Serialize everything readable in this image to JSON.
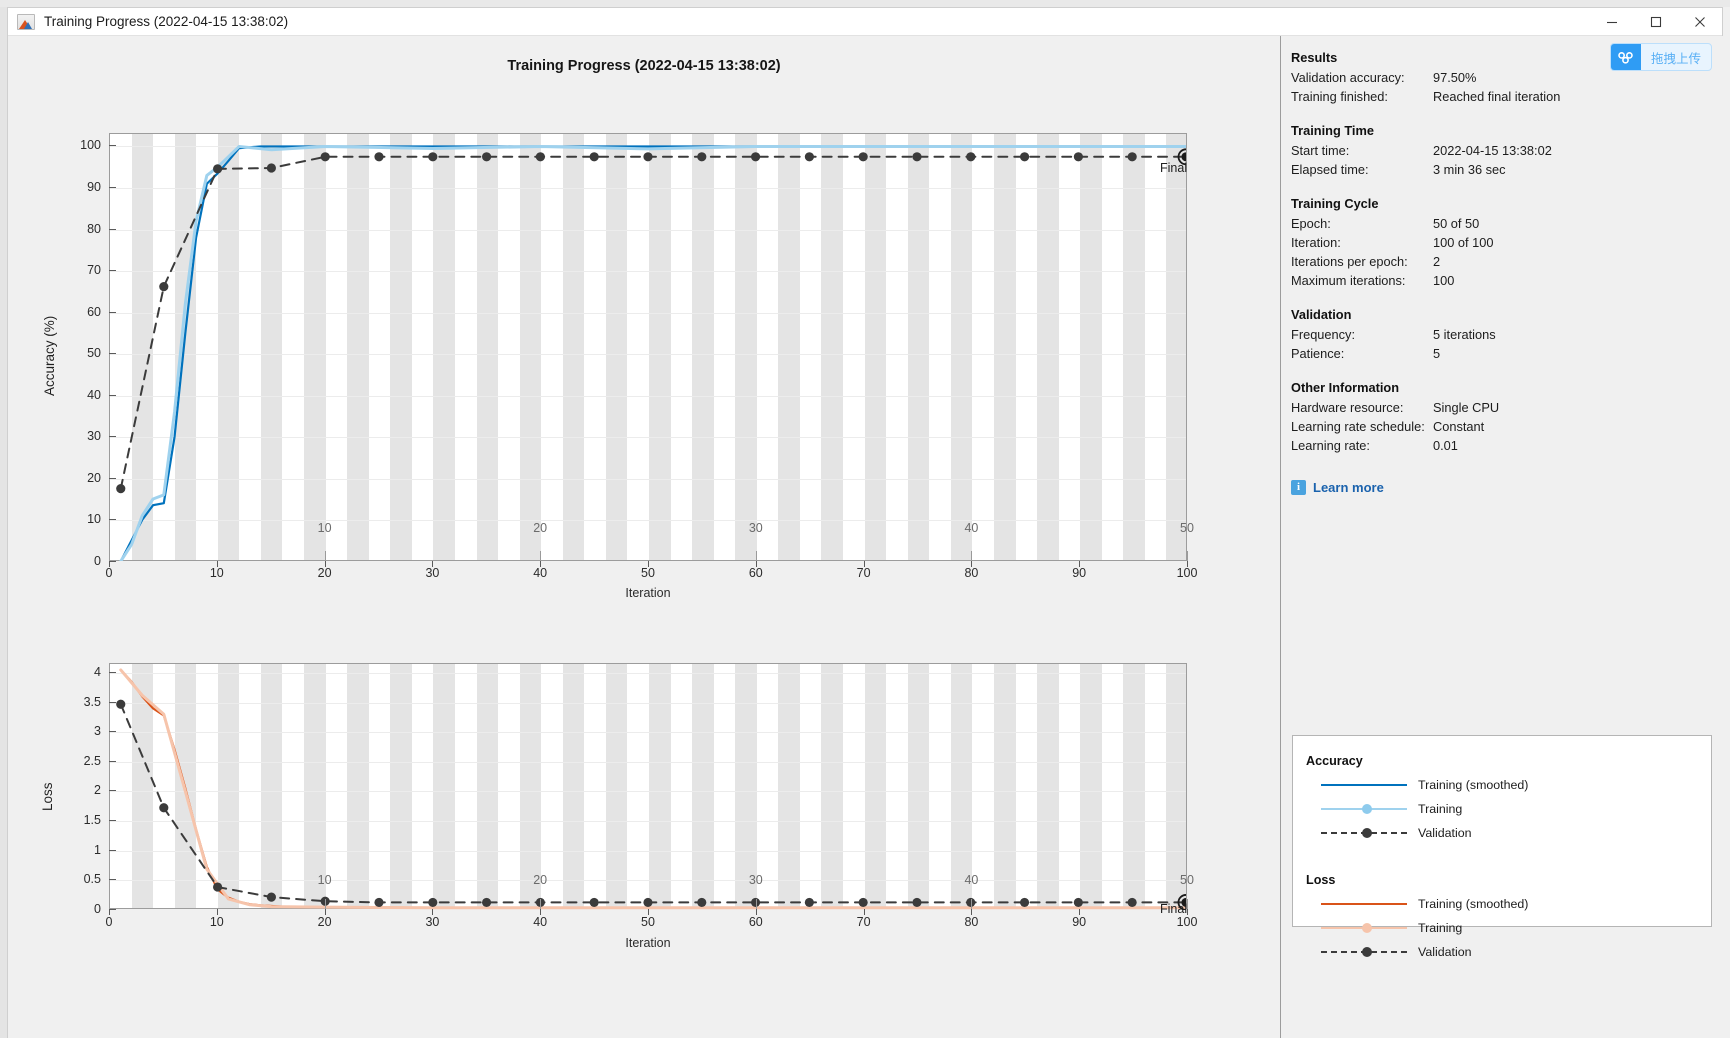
{
  "window": {
    "title": "Training Progress (2022-04-15 13:38:02)",
    "icon": "matlab-icon",
    "minimize_label": "—",
    "maximize_label": "□",
    "close_label": "×"
  },
  "overlay": {
    "upload_icon": "baidu-netdisk-icon",
    "upload_label": "拖拽上传"
  },
  "plot": {
    "title": "Training Progress (2022-04-15 13:38:02)",
    "final_label_top": "Final",
    "final_label_bottom": "Final"
  },
  "info": {
    "sections": [
      {
        "heading": "Results",
        "rows": [
          {
            "key": "Validation accuracy:",
            "value": "97.50%"
          },
          {
            "key": "Training finished:",
            "value": "Reached final iteration"
          }
        ]
      },
      {
        "heading": "Training Time",
        "rows": [
          {
            "key": "Start time:",
            "value": "2022-04-15 13:38:02"
          },
          {
            "key": "Elapsed time:",
            "value": "3 min 36 sec"
          }
        ]
      },
      {
        "heading": "Training Cycle",
        "rows": [
          {
            "key": "Epoch:",
            "value": "50 of 50"
          },
          {
            "key": "Iteration:",
            "value": "100 of 100"
          },
          {
            "key": "Iterations per epoch:",
            "value": "2"
          },
          {
            "key": "Maximum iterations:",
            "value": "100"
          }
        ]
      },
      {
        "heading": "Validation",
        "rows": [
          {
            "key": "Frequency:",
            "value": "5 iterations"
          },
          {
            "key": "Patience:",
            "value": "5"
          }
        ]
      },
      {
        "heading": "Other Information",
        "rows": [
          {
            "key": "Hardware resource:",
            "value": "Single CPU"
          },
          {
            "key": "Learning rate schedule:",
            "value": "Constant"
          },
          {
            "key": "Learning rate:",
            "value": "0.01"
          }
        ]
      }
    ],
    "learn_more": {
      "icon": "info-icon",
      "label": "Learn more"
    }
  },
  "legend": {
    "groups": [
      {
        "title": "Accuracy",
        "items": [
          {
            "label": "Training (smoothed)",
            "style": "solid",
            "color": "#0072bd",
            "marker": false
          },
          {
            "label": "Training",
            "style": "solid",
            "color": "#9fd2ee",
            "marker": true,
            "marker_color": "#8ecbed"
          },
          {
            "label": "Validation",
            "style": "dashed",
            "color": "#3b3b3b",
            "marker": true,
            "marker_color": "#3b3b3b"
          }
        ]
      },
      {
        "title": "Loss",
        "items": [
          {
            "label": "Training (smoothed)",
            "style": "solid",
            "color": "#d95319",
            "marker": false
          },
          {
            "label": "Training",
            "style": "solid",
            "color": "#f6c4ab",
            "marker": true,
            "marker_color": "#f6c4ab"
          },
          {
            "label": "Validation",
            "style": "dashed",
            "color": "#3b3b3b",
            "marker": true,
            "marker_color": "#3b3b3b"
          }
        ]
      }
    ]
  },
  "chart_data": [
    {
      "id": "accuracy-chart",
      "type": "line",
      "title": "Accuracy",
      "xlabel": "Iteration",
      "ylabel": "Accuracy (%)",
      "xlim": [
        0,
        100
      ],
      "ylim": [
        0,
        103
      ],
      "xticks": [
        0,
        10,
        20,
        30,
        40,
        50,
        60,
        70,
        80,
        90,
        100
      ],
      "yticks": [
        0,
        10,
        20,
        30,
        40,
        50,
        60,
        70,
        80,
        90,
        100
      ],
      "epoch_ticks": [
        10,
        20,
        30,
        40,
        50
      ],
      "epoch_tick_iterations": [
        20,
        40,
        60,
        80,
        100
      ],
      "grid": true,
      "epoch_bands": true,
      "iterations_per_epoch": 2,
      "series": [
        {
          "name": "Training (smoothed)",
          "color": "#0072bd",
          "style": "solid",
          "x": [
            1,
            2,
            3,
            4,
            5,
            6,
            7,
            8,
            9,
            10,
            11,
            12,
            14,
            16,
            18,
            20,
            30,
            40,
            50,
            60,
            70,
            80,
            90,
            100
          ],
          "y": [
            0,
            5,
            10,
            13.5,
            14,
            30,
            55,
            78,
            91,
            93.5,
            96.5,
            99.6,
            100,
            100,
            100,
            100,
            100,
            100,
            100,
            100,
            100,
            100,
            100,
            100
          ]
        },
        {
          "name": "Training",
          "color": "#9fd2ee",
          "style": "solid",
          "x": [
            1,
            2,
            3,
            4,
            5,
            6,
            7,
            8,
            9,
            10,
            11,
            12,
            15,
            20,
            30,
            40,
            50,
            60,
            70,
            80,
            90,
            100
          ],
          "y": [
            0,
            4,
            11,
            15,
            16,
            36,
            62,
            82,
            93,
            95,
            97.5,
            100,
            99.2,
            100,
            99.5,
            100,
            99.4,
            100,
            100,
            100,
            100,
            100
          ]
        },
        {
          "name": "Validation",
          "color": "#3b3b3b",
          "style": "dashed",
          "marker": "circle",
          "x": [
            1,
            5,
            10,
            15,
            20,
            25,
            30,
            35,
            40,
            45,
            50,
            55,
            60,
            65,
            70,
            75,
            80,
            85,
            90,
            95,
            100
          ],
          "y": [
            17.5,
            66.2,
            94.6,
            94.8,
            97.5,
            97.5,
            97.5,
            97.5,
            97.5,
            97.5,
            97.5,
            97.5,
            97.5,
            97.5,
            97.5,
            97.5,
            97.5,
            97.5,
            97.5,
            97.5,
            97.5
          ]
        }
      ],
      "final_marker": {
        "x": 100,
        "y": 97.5,
        "label": "Final"
      }
    },
    {
      "id": "loss-chart",
      "type": "line",
      "title": "Loss",
      "xlabel": "Iteration",
      "ylabel": "Loss",
      "xlim": [
        0,
        100
      ],
      "ylim": [
        0,
        4.15
      ],
      "xticks": [
        0,
        10,
        20,
        30,
        40,
        50,
        60,
        70,
        80,
        90,
        100
      ],
      "yticks": [
        0,
        0.5,
        1,
        1.5,
        2,
        2.5,
        3,
        3.5,
        4
      ],
      "epoch_ticks": [
        10,
        20,
        30,
        40,
        50
      ],
      "epoch_tick_iterations": [
        20,
        40,
        60,
        80,
        100
      ],
      "grid": true,
      "epoch_bands": true,
      "iterations_per_epoch": 2,
      "series": [
        {
          "name": "Training (smoothed)",
          "color": "#d95319",
          "style": "solid",
          "x": [
            1,
            2,
            3,
            4,
            5,
            6,
            7,
            8,
            9,
            10,
            11,
            12,
            13,
            14,
            15,
            16,
            18,
            20,
            30,
            40,
            50,
            60,
            70,
            80,
            90,
            100
          ],
          "y": [
            4.05,
            3.85,
            3.6,
            3.4,
            3.28,
            2.7,
            2.05,
            1.35,
            0.72,
            0.34,
            0.2,
            0.13,
            0.09,
            0.07,
            0.06,
            0.05,
            0.04,
            0.04,
            0.03,
            0.03,
            0.03,
            0.03,
            0.03,
            0.03,
            0.03,
            0.03
          ]
        },
        {
          "name": "Training",
          "color": "#f6c4ab",
          "style": "solid",
          "x": [
            1,
            3,
            5,
            7,
            9,
            11,
            13,
            15,
            20,
            30,
            40,
            50,
            60,
            70,
            80,
            90,
            100
          ],
          "y": [
            4.05,
            3.62,
            3.3,
            2.0,
            0.68,
            0.18,
            0.08,
            0.05,
            0.04,
            0.03,
            0.03,
            0.03,
            0.03,
            0.03,
            0.03,
            0.03,
            0.03
          ]
        },
        {
          "name": "Validation",
          "color": "#3b3b3b",
          "style": "dashed",
          "marker": "circle",
          "x": [
            1,
            5,
            10,
            15,
            20,
            25,
            30,
            35,
            40,
            45,
            50,
            55,
            60,
            65,
            70,
            75,
            80,
            85,
            90,
            95,
            100
          ],
          "y": [
            3.47,
            1.72,
            0.38,
            0.21,
            0.14,
            0.12,
            0.12,
            0.12,
            0.12,
            0.12,
            0.12,
            0.12,
            0.12,
            0.12,
            0.12,
            0.12,
            0.12,
            0.12,
            0.12,
            0.12,
            0.12
          ]
        }
      ],
      "final_marker": {
        "x": 100,
        "y": 0.12,
        "label": "Final"
      }
    }
  ]
}
